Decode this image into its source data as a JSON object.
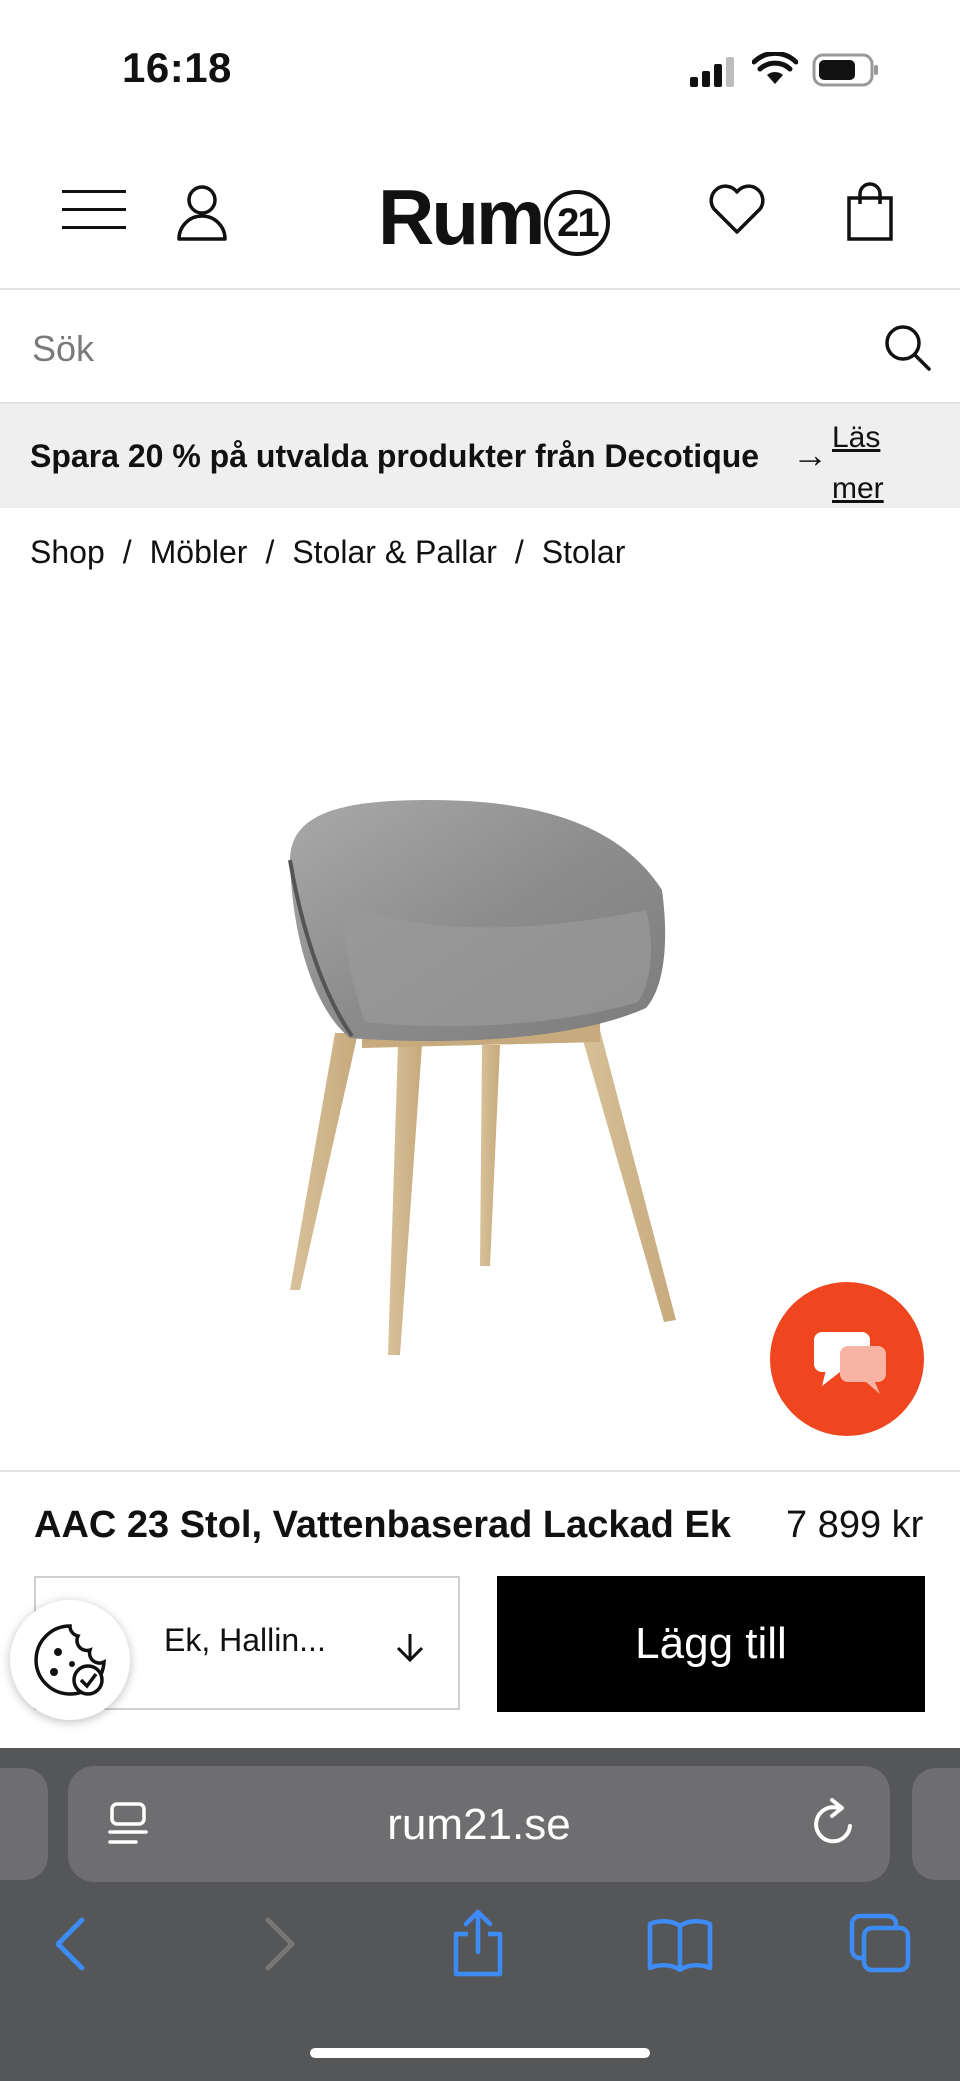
{
  "status_bar": {
    "time": "16:18"
  },
  "header": {
    "logo_text": "Rum",
    "logo_badge": "21",
    "menu_icon": "hamburger-icon",
    "account_icon": "user-icon",
    "wishlist_icon": "heart-icon",
    "cart_icon": "shopping-bag-icon"
  },
  "search": {
    "placeholder": "Sök"
  },
  "promo": {
    "text": "Spara 20 % på utvalda produkter från Decotique",
    "arrow": "→",
    "link": "Läs mer"
  },
  "breadcrumb": [
    "Shop",
    "Möbler",
    "Stolar & Pallar",
    "Stolar"
  ],
  "breadcrumb_separator": "/",
  "product": {
    "name": "AAC 23 Stol, Vattenbaserad Lackad Ek",
    "price": "7 899 kr",
    "variant": "Ek, Hallin...",
    "add_button": "Lägg till"
  },
  "colors": {
    "chat_button": "#f0461f",
    "add_button": "#000000",
    "safari_bar": "#555658",
    "safari_accent": "#3d8bf5"
  },
  "browser": {
    "url": "rum21.se"
  }
}
